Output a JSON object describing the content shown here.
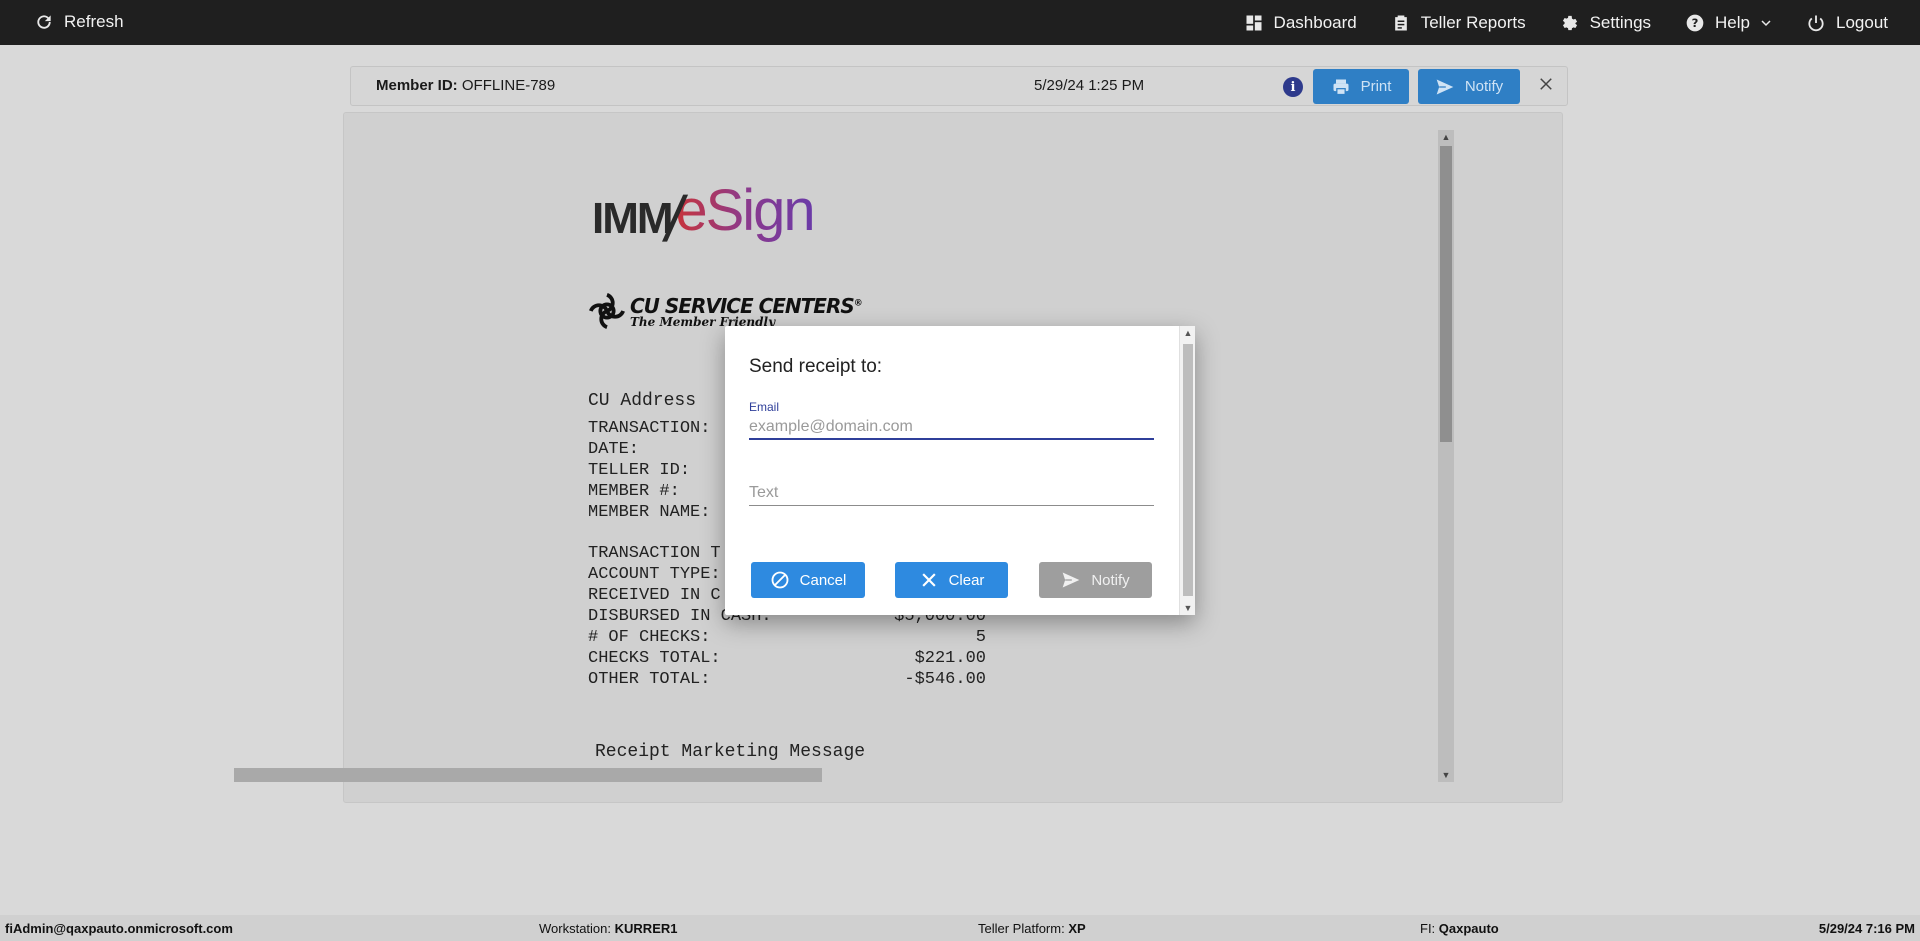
{
  "topbar": {
    "refresh": "Refresh",
    "dashboard": "Dashboard",
    "teller_reports": "Teller Reports",
    "settings": "Settings",
    "help": "Help",
    "logout": "Logout"
  },
  "member_bar": {
    "member_id_label": "Member ID:",
    "member_id": "OFFLINE-789",
    "datetime": "5/29/24 1:25 PM",
    "info": "i",
    "print": "Print",
    "notify": "Notify"
  },
  "receipt": {
    "logo_imm": "IMM",
    "logo_esign": "eSign",
    "cu_name": "CU SERVICE CENTERS",
    "cu_registered": "®",
    "cu_tagline": "The Member Friendly",
    "cu_address": "CU Address",
    "lines": [
      "TRANSACTION:",
      "DATE:",
      "TELLER ID:",
      "MEMBER #:",
      "MEMBER NAME:"
    ],
    "rows": [
      {
        "key": "TRANSACTION T",
        "value": ""
      },
      {
        "key": "ACCOUNT TYPE:",
        "value": ""
      },
      {
        "key": "RECEIVED IN C",
        "value": ""
      },
      {
        "key": "DISBURSED IN CASH:",
        "value": "$5,000.00"
      },
      {
        "key": "# OF CHECKS:",
        "value": "5"
      },
      {
        "key": "CHECKS TOTAL:",
        "value": "$221.00"
      },
      {
        "key": "OTHER TOTAL:",
        "value": "-$546.00"
      }
    ],
    "marketing": "Receipt Marketing Message"
  },
  "modal": {
    "title": "Send receipt to:",
    "email_label": "Email",
    "email_placeholder": "example@domain.com",
    "text_placeholder": "Text",
    "cancel": "Cancel",
    "clear": "Clear",
    "notify": "Notify"
  },
  "statusbar": {
    "user": "fiAdmin@qaxpauto.onmicrosoft.com",
    "workstation_label": "Workstation:",
    "workstation": "KURRER1",
    "platform_label": "Teller Platform:",
    "platform": "XP",
    "fi_label": "FI:",
    "fi": "Qaxpauto",
    "datetime": "5/29/24 7:16 PM"
  },
  "colors": {
    "topbar": "#1f1f1f",
    "primary_button": "#2e8ae0",
    "disabled_button": "#9e9e9e",
    "input_accent": "#2f3f9a"
  }
}
